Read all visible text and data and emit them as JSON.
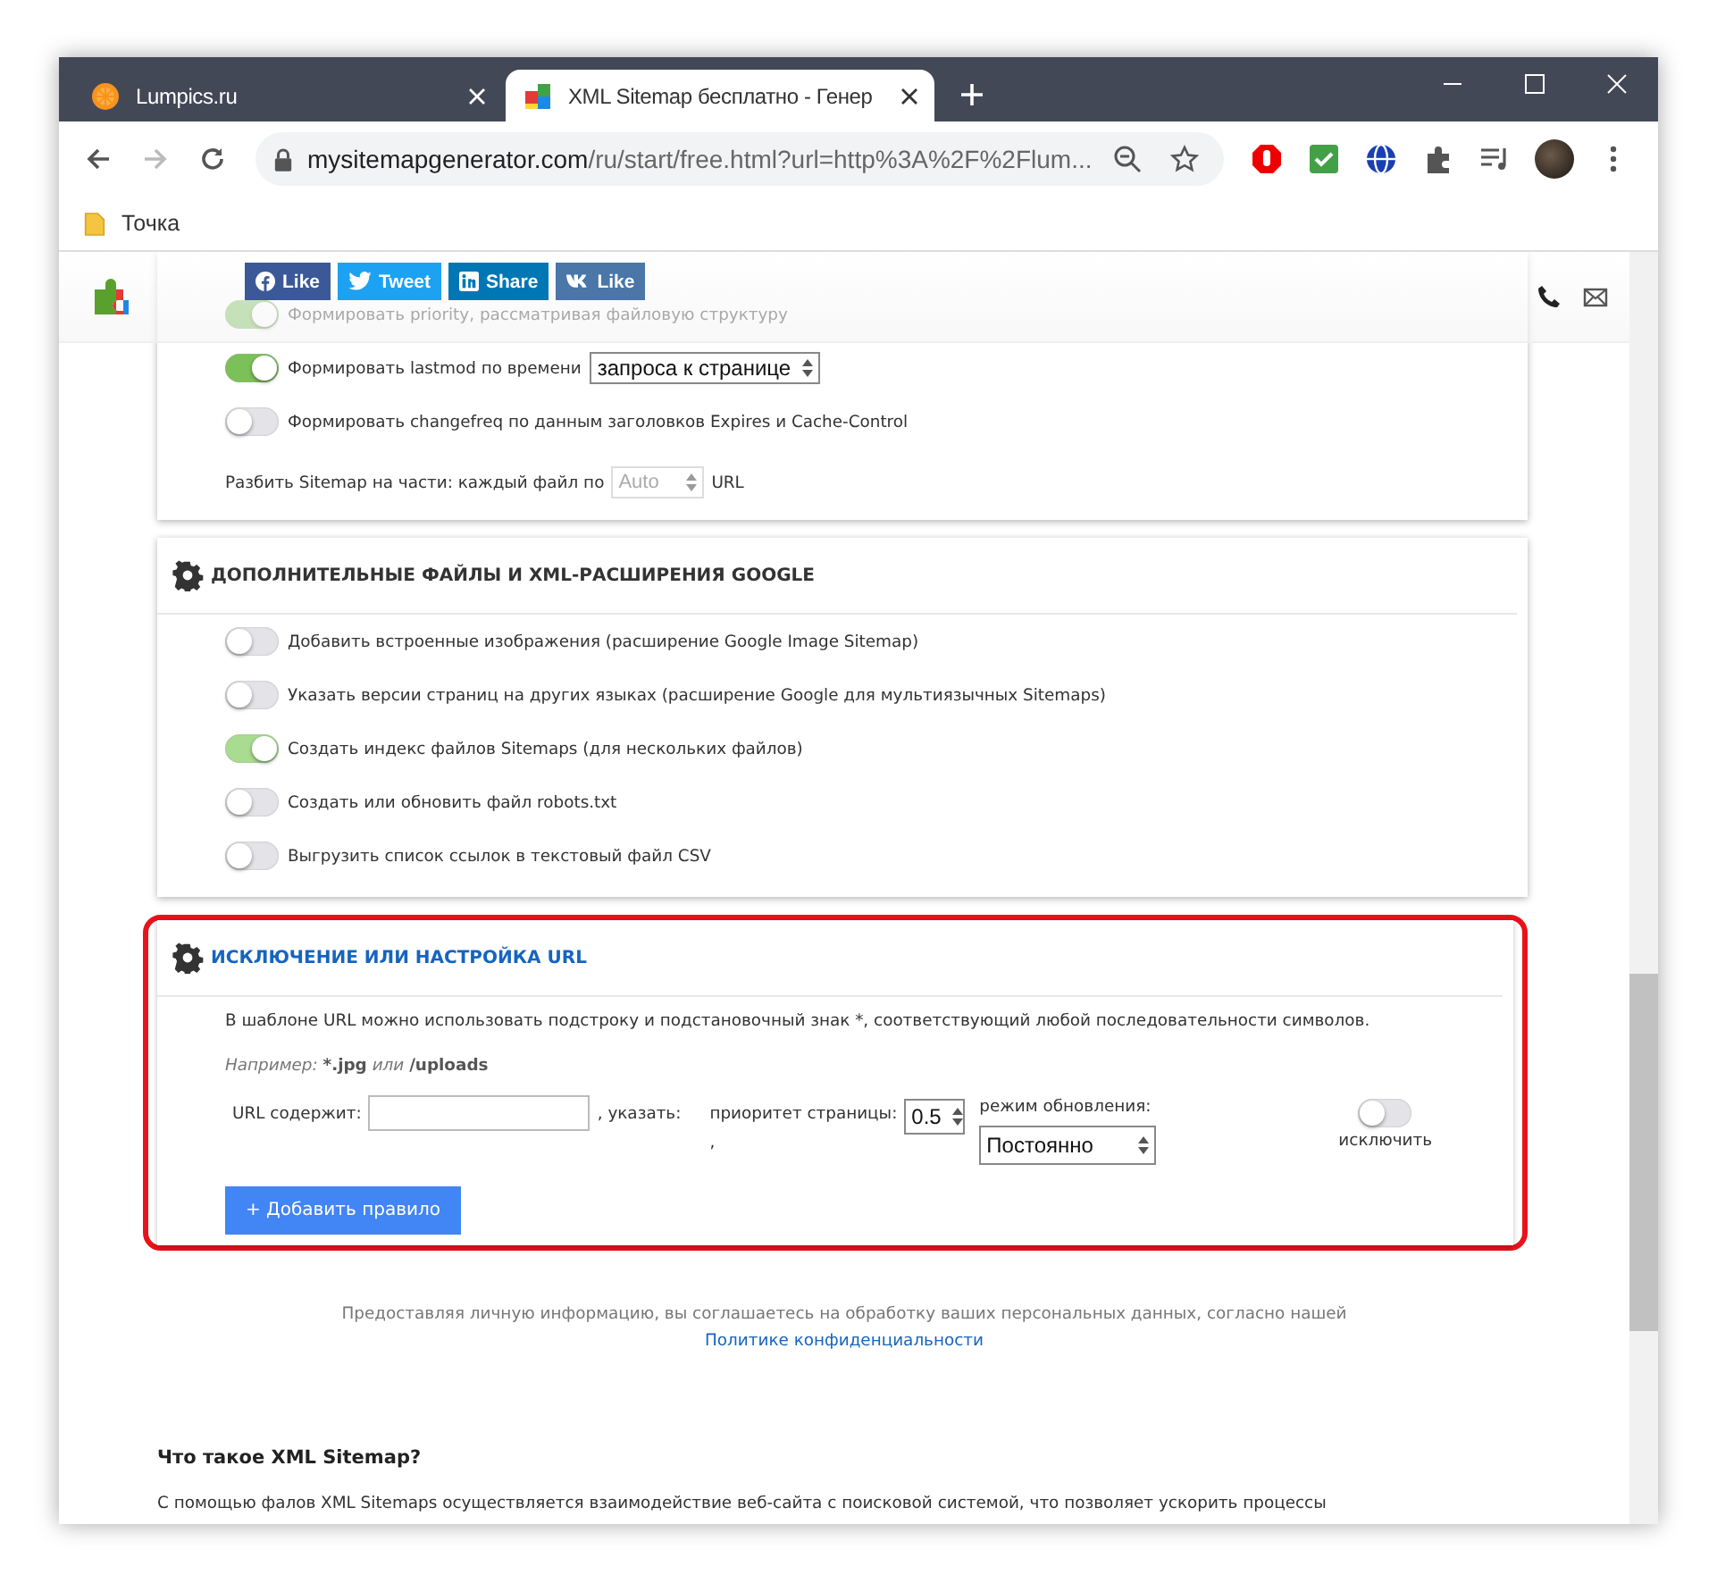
{
  "browser": {
    "tabs": [
      {
        "title": "Lumpics.ru",
        "selected": false,
        "kind": "orange"
      },
      {
        "title": "XML Sitemap бесплатно - Генер",
        "selected": true,
        "kind": "puzzle"
      }
    ],
    "url_host": "mysitemapgenerator.com",
    "url_path": "/ru/start/free.html?url=http%3A%2F%2Flum...",
    "bookmarks": [
      {
        "label": "Точка"
      }
    ]
  },
  "header": {
    "social_buttons": [
      {
        "label": "Like",
        "kind": "facebook",
        "color": "#3b5998"
      },
      {
        "label": "Tweet",
        "kind": "twitter",
        "color": "#1da1f2"
      },
      {
        "label": "Share",
        "kind": "linkedin",
        "color": "#0077b5"
      },
      {
        "label": "Like",
        "kind": "vk",
        "color": "#4a76a8"
      }
    ]
  },
  "card_1": {
    "options": [
      {
        "label": "Формировать priority, рассматривая файловую структуру",
        "on": true
      },
      {
        "label": "Формировать lastmod по времени",
        "on": true,
        "select": "запроса к странице"
      },
      {
        "label": "Формировать changefreq по данным заголовков Expires и Cache-Control",
        "on": false
      }
    ],
    "split_label": "Разбить Sitemap на части: каждый файл по",
    "split_select": "Auto",
    "split_suffix": "URL"
  },
  "card_2": {
    "title": "ДОПОЛНИТЕЛЬНЫЕ ФАЙЛЫ И XML-РАСШИРЕНИЯ GOOGLE",
    "options": [
      {
        "label": "Добавить встроенные изображения (расширение Google Image Sitemap)",
        "on": false
      },
      {
        "label": "Указать версии страниц на других языках (расширение Google для мультиязычных Sitemaps)",
        "on": false
      },
      {
        "label": "Создать индекс файлов Sitemaps (для нескольких файлов)",
        "on": true
      },
      {
        "label": "Создать или обновить файл robots.txt",
        "on": false
      },
      {
        "label": "Выгрузить список ссылок в текстовый файл CSV",
        "on": false
      }
    ]
  },
  "card_3": {
    "title": "ИСКЛЮЧЕНИЕ ИЛИ НАСТРОЙКА URL",
    "highlighted": true,
    "description": "В шаблоне URL можно использовать подстроку и подстановочный знак *, соответствующий любой последовательности символов.",
    "example": [
      {
        "text": "Например:",
        "kind": "italic"
      },
      {
        "text": "*.jpg",
        "kind": "bold"
      },
      {
        "text": "или",
        "kind": "italic"
      },
      {
        "text": "/uploads",
        "kind": "bold"
      }
    ],
    "rule": {
      "url_label": "URL содержит:",
      "specify_label": ", указать:",
      "priority_label": "приоритет страницы:",
      "priority_comma": ",",
      "priority": "0.5",
      "mode_label": "режим обновления:",
      "mode": "Постоянно",
      "exclude_on": false,
      "exclude_label": "исключить"
    },
    "add_button": "+ Добавить правило"
  },
  "consent": {
    "text": "Предоставляя личную информацию, вы соглашаетесь на обработку ваших персональных данных, согласно нашей",
    "link": "Политике конфиденциальности"
  },
  "article": {
    "heading": "Что такое XML Sitemap?",
    "text": "С помощью фалов XML Sitemaps осуществляется взаимодействие веб-сайта с поисковой системой, что позволяет ускорить процессы"
  }
}
